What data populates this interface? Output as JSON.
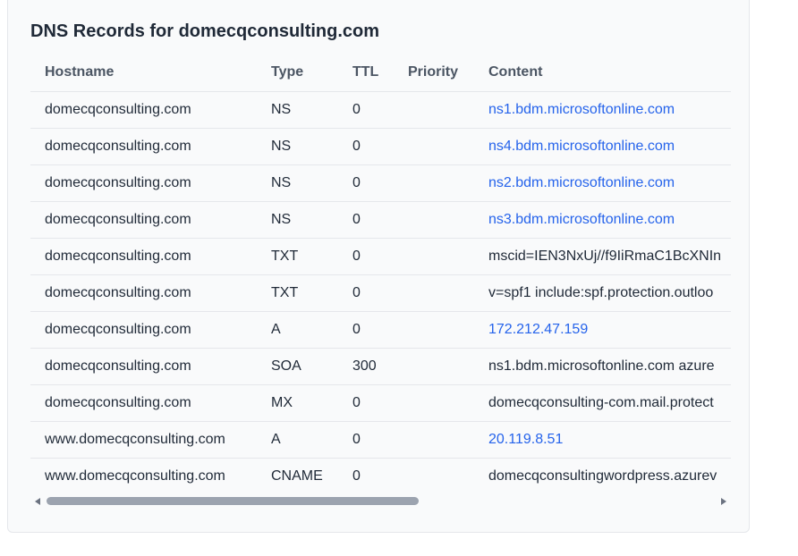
{
  "title": "DNS Records for domecqconsulting.com",
  "columns": [
    "Hostname",
    "Type",
    "TTL",
    "Priority",
    "Content"
  ],
  "rows": [
    {
      "hostname": "domecqconsulting.com",
      "type": "NS",
      "ttl": "0",
      "priority": "",
      "content": "ns1.bdm.microsoftonline.com",
      "is_link": true
    },
    {
      "hostname": "domecqconsulting.com",
      "type": "NS",
      "ttl": "0",
      "priority": "",
      "content": "ns4.bdm.microsoftonline.com",
      "is_link": true
    },
    {
      "hostname": "domecqconsulting.com",
      "type": "NS",
      "ttl": "0",
      "priority": "",
      "content": "ns2.bdm.microsoftonline.com",
      "is_link": true
    },
    {
      "hostname": "domecqconsulting.com",
      "type": "NS",
      "ttl": "0",
      "priority": "",
      "content": "ns3.bdm.microsoftonline.com",
      "is_link": true
    },
    {
      "hostname": "domecqconsulting.com",
      "type": "TXT",
      "ttl": "0",
      "priority": "",
      "content": "mscid=IEN3NxUj//f9IiRmaC1BcXNIn",
      "is_link": false
    },
    {
      "hostname": "domecqconsulting.com",
      "type": "TXT",
      "ttl": "0",
      "priority": "",
      "content": "v=spf1 include:spf.protection.outloo",
      "is_link": false
    },
    {
      "hostname": "domecqconsulting.com",
      "type": "A",
      "ttl": "0",
      "priority": "",
      "content": "172.212.47.159",
      "is_link": true
    },
    {
      "hostname": "domecqconsulting.com",
      "type": "SOA",
      "ttl": "300",
      "priority": "",
      "content": "ns1.bdm.microsoftonline.com azure",
      "is_link": false
    },
    {
      "hostname": "domecqconsulting.com",
      "type": "MX",
      "ttl": "0",
      "priority": "",
      "content": "domecqconsulting-com.mail.protect",
      "is_link": false
    },
    {
      "hostname": "www.domecqconsulting.com",
      "type": "A",
      "ttl": "0",
      "priority": "",
      "content": "20.119.8.51",
      "is_link": true
    },
    {
      "hostname": "www.domecqconsulting.com",
      "type": "CNAME",
      "ttl": "0",
      "priority": "",
      "content": "domecqconsultingwordpress.azurev",
      "is_link": false
    }
  ],
  "colors": {
    "link": "#2563eb",
    "text": "#1f2937",
    "header_text": "#4b5563",
    "card_bg": "#f9fafb",
    "border": "#e5e7eb",
    "scroll_thumb": "#9ca3af"
  },
  "icons": {
    "scroll_left": "scroll-left-arrow-icon",
    "scroll_right": "scroll-right-arrow-icon"
  }
}
